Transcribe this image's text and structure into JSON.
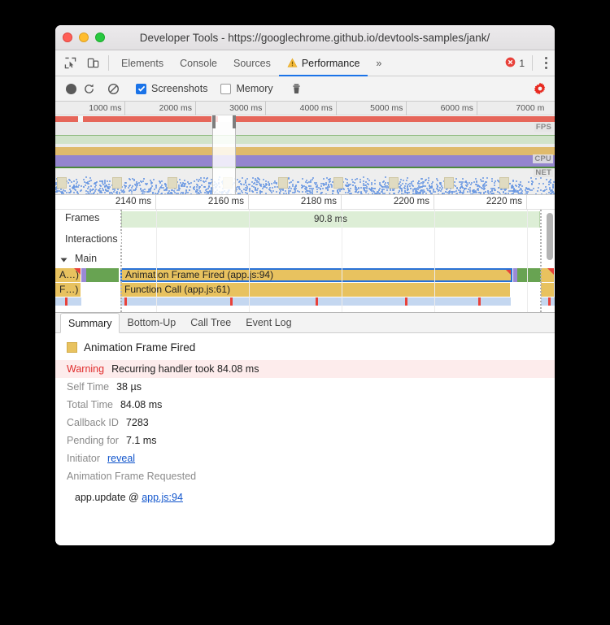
{
  "window": {
    "title": "Developer Tools - https://googlechrome.github.io/devtools-samples/jank/",
    "traffic_lights": [
      "close-red",
      "minimize-yellow",
      "maximize-green"
    ]
  },
  "tabstrip": {
    "left_icons": [
      "inspect-element-icon",
      "device-toolbar-icon"
    ],
    "tabs": [
      {
        "label": "Elements",
        "active": false,
        "warning": false
      },
      {
        "label": "Console",
        "active": false,
        "warning": false
      },
      {
        "label": "Sources",
        "active": false,
        "warning": false
      },
      {
        "label": "Performance",
        "active": true,
        "warning": true
      }
    ],
    "overflow_label": "»",
    "error_count": "1",
    "more_icon": "vertical-dots-icon"
  },
  "toolbar": {
    "record_label": "record-button",
    "reload_label": "reload-and-record-button",
    "clear_label": "clear-recording-button",
    "screenshots_label": "Screenshots",
    "screenshots_checked": true,
    "memory_label": "Memory",
    "memory_checked": false,
    "trash_label": "collect-garbage-button",
    "settings_label": "capture-settings-button",
    "accent": "#1a73e8",
    "gear_color": "#e8291f"
  },
  "overview": {
    "ruler_ticks": [
      "1000 ms",
      "2000 ms",
      "3000 ms",
      "4000 ms",
      "5000 ms",
      "6000 ms",
      "7000 m"
    ],
    "bands": [
      {
        "name": "FPS",
        "color": "#d9ecd3"
      },
      {
        "name": "CPU",
        "color": "#e8c170"
      },
      {
        "name": "NET",
        "color": "#6d9eeb"
      }
    ],
    "selection": {
      "start_pct": 31.5,
      "end_pct": 36.1
    }
  },
  "detail": {
    "ruler_ticks": [
      "2140 ms",
      "2160 ms",
      "2180 ms",
      "2200 ms",
      "2220 ms"
    ],
    "tracks": [
      {
        "name": "Frames",
        "type": "frames"
      },
      {
        "name": "Interactions",
        "type": "interactions"
      },
      {
        "name": "Main",
        "type": "main",
        "expanded": true,
        "expander": "▼"
      }
    ],
    "frame_duration": "90.8 ms",
    "bars": [
      {
        "label": "A…)",
        "row": 0,
        "color": "yellow",
        "warning": true
      },
      {
        "label": "Animation Frame Fired (app.js:94)",
        "row": 0,
        "color": "yellow",
        "selected": true,
        "warning": true
      },
      {
        "label": "F…)",
        "row": 1,
        "color": "yellow"
      },
      {
        "label": "Function Call (app.js:61)",
        "row": 1,
        "color": "yellow"
      }
    ]
  },
  "bottom_tabs": [
    {
      "label": "Summary",
      "active": true
    },
    {
      "label": "Bottom-Up",
      "active": false
    },
    {
      "label": "Call Tree",
      "active": false
    },
    {
      "label": "Event Log",
      "active": false
    }
  ],
  "summary": {
    "event_title": "Animation Frame Fired",
    "swatch_color": "#e8c25f",
    "rows": [
      {
        "label": "Warning",
        "value": "Recurring handler took 84.08 ms",
        "style": "warning"
      },
      {
        "label": "Self Time",
        "value": "38 µs",
        "style": "normal"
      },
      {
        "label": "Total Time",
        "value": "84.08 ms",
        "style": "normal"
      },
      {
        "label": "Callback ID",
        "value": "7283",
        "style": "normal"
      },
      {
        "label": "Pending for",
        "value": "7.1 ms",
        "style": "normal"
      },
      {
        "label": "Initiator",
        "value": "reveal",
        "style": "link"
      },
      {
        "label": "Animation Frame Requested",
        "value": "",
        "style": "single"
      }
    ],
    "stack_fn": "app.update @ ",
    "stack_link": "app.js:94"
  }
}
